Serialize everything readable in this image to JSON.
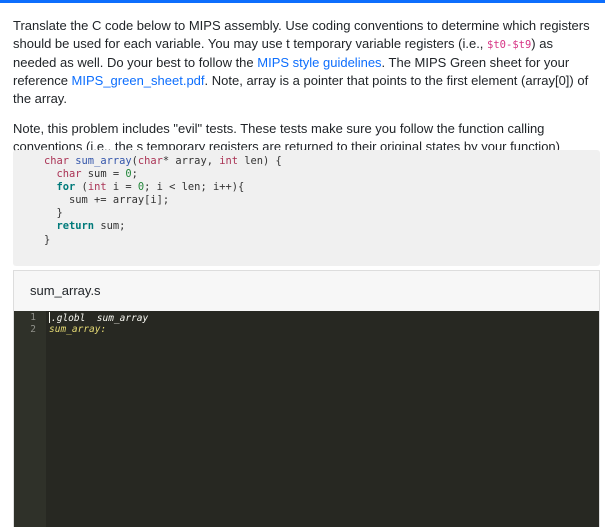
{
  "prompt": {
    "p1_a": "Translate the C code below to MIPS assembly. Use coding conventions to determine which registers should be used for each variable. You may use t temporary variable registers (i.e., ",
    "p1_code": "$t0-$t9",
    "p1_b": ") as needed as well. Do your best to follow the ",
    "p1_link1": "MIPS style guidelines",
    "p1_c": ". The MIPS Green sheet for your reference ",
    "p1_link2": "MIPS_green_sheet.pdf",
    "p1_d": ". Note, array is a pointer that points to the first element (array[0]) of the array.",
    "p2": "Note, this problem includes \"evil\" tests. These tests make sure you follow the function calling conventions (i.e., the s temporary registers are returned to their original states by your function)"
  },
  "c_code": {
    "line1": "char sum_array(char* array, int len) {",
    "line2": "  char sum = 0;",
    "line3": "  for (int i = 0; i < len; i++){",
    "line4": "    sum += array[i];",
    "line5": "  }",
    "line6": "  return sum;",
    "line7": "}"
  },
  "editor": {
    "filename": "sum_array.s",
    "line_numbers": [
      "1",
      "2"
    ],
    "lines": [
      ".globl  sum_array",
      "sum_array:"
    ]
  },
  "colors": {
    "accent": "#0d6efd",
    "editor_bg": "#272822",
    "inline_code": "#d63384"
  }
}
